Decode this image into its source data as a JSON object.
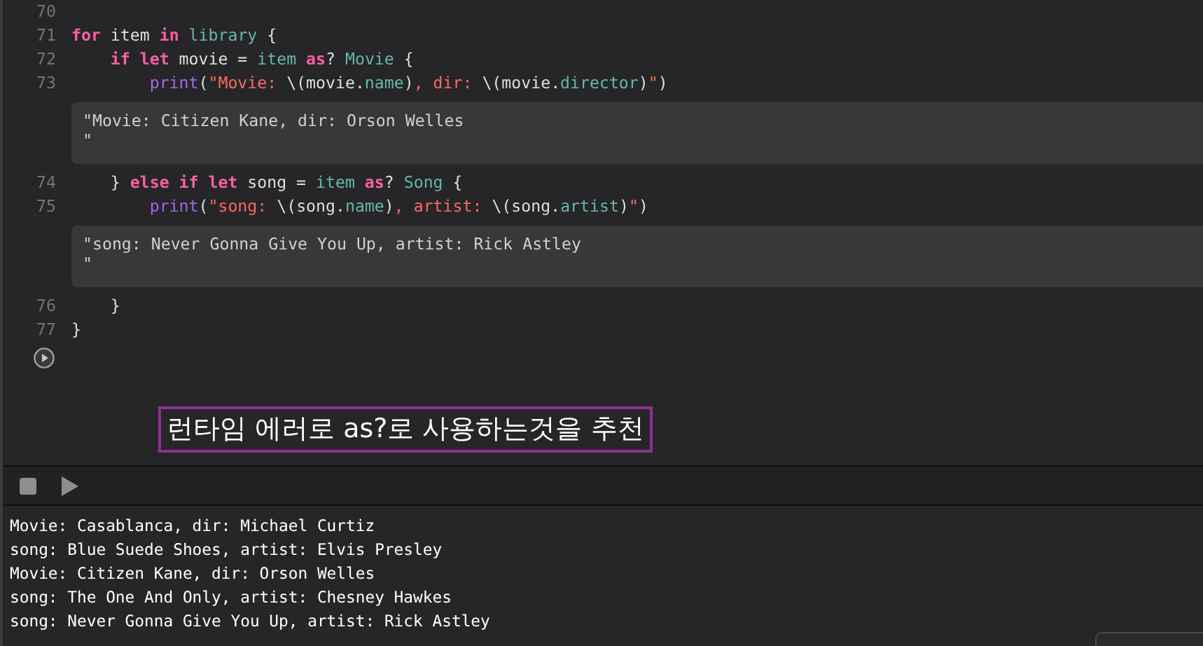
{
  "editor": {
    "rows": [
      {
        "kind": "code",
        "number": "70",
        "tokens": []
      },
      {
        "kind": "code",
        "number": "71",
        "tokens": [
          {
            "kind": "keyword",
            "text": "for"
          },
          {
            "kind": "plain",
            "text": " item "
          },
          {
            "kind": "keyword",
            "text": "in"
          },
          {
            "kind": "ident",
            "text": " library"
          },
          {
            "kind": "plain",
            "text": " {"
          }
        ]
      },
      {
        "kind": "code",
        "number": "72",
        "tokens": [
          {
            "kind": "keyword",
            "text": "    if let"
          },
          {
            "kind": "plain",
            "text": " movie = "
          },
          {
            "kind": "ident",
            "text": "item"
          },
          {
            "kind": "keyword",
            "text": " as"
          },
          {
            "kind": "plain",
            "text": "? "
          },
          {
            "kind": "ident",
            "text": "Movie"
          },
          {
            "kind": "plain",
            "text": " {"
          }
        ]
      },
      {
        "kind": "code",
        "number": "73",
        "tokens": [
          {
            "kind": "func",
            "text": "        print"
          },
          {
            "kind": "plain",
            "text": "("
          },
          {
            "kind": "string",
            "text": "\"Movie: "
          },
          {
            "kind": "plain",
            "text": "\\(movie."
          },
          {
            "kind": "ident",
            "text": "name"
          },
          {
            "kind": "plain",
            "text": ")"
          },
          {
            "kind": "string",
            "text": ", dir: "
          },
          {
            "kind": "plain",
            "text": "\\(movie."
          },
          {
            "kind": "ident",
            "text": "director"
          },
          {
            "kind": "plain",
            "text": ")"
          },
          {
            "kind": "string",
            "text": "\""
          },
          {
            "kind": "plain",
            "text": ")"
          }
        ]
      },
      {
        "kind": "result",
        "text": "\"Movie: Citizen Kane, dir: Orson Welles\n\""
      },
      {
        "kind": "code",
        "number": "74",
        "tokens": [
          {
            "kind": "plain",
            "text": "    } "
          },
          {
            "kind": "keyword",
            "text": "else if let"
          },
          {
            "kind": "plain",
            "text": " song = "
          },
          {
            "kind": "ident",
            "text": "item"
          },
          {
            "kind": "keyword",
            "text": " as"
          },
          {
            "kind": "plain",
            "text": "? "
          },
          {
            "kind": "ident",
            "text": "Song"
          },
          {
            "kind": "plain",
            "text": " {"
          }
        ]
      },
      {
        "kind": "code",
        "number": "75",
        "tokens": [
          {
            "kind": "func",
            "text": "        print"
          },
          {
            "kind": "plain",
            "text": "("
          },
          {
            "kind": "string",
            "text": "\"song: "
          },
          {
            "kind": "plain",
            "text": "\\(song."
          },
          {
            "kind": "ident",
            "text": "name"
          },
          {
            "kind": "plain",
            "text": ")"
          },
          {
            "kind": "string",
            "text": ", artist: "
          },
          {
            "kind": "plain",
            "text": "\\(song."
          },
          {
            "kind": "ident",
            "text": "artist"
          },
          {
            "kind": "plain",
            "text": ")"
          },
          {
            "kind": "string",
            "text": "\""
          },
          {
            "kind": "plain",
            "text": ")"
          }
        ]
      },
      {
        "kind": "result",
        "text": "\"song: Never Gonna Give You Up, artist: Rick Astley\n\""
      },
      {
        "kind": "code",
        "number": "76",
        "tokens": [
          {
            "kind": "plain",
            "text": "    }"
          }
        ]
      },
      {
        "kind": "code",
        "number": "77",
        "tokens": [
          {
            "kind": "plain",
            "text": "}"
          }
        ]
      }
    ]
  },
  "annotation": "런타임 에러로 as?로 사용하는것을 추천",
  "console": {
    "lines": [
      "Movie: Casablanca, dir: Michael Curtiz",
      "song: Blue Suede Shoes, artist: Elvis Presley",
      "Movie: Citizen Kane, dir: Orson Welles",
      "song: The One And Only, artist: Chesney Hawkes",
      "song: Never Gonna Give You Up, artist: Rick Astley"
    ]
  }
}
